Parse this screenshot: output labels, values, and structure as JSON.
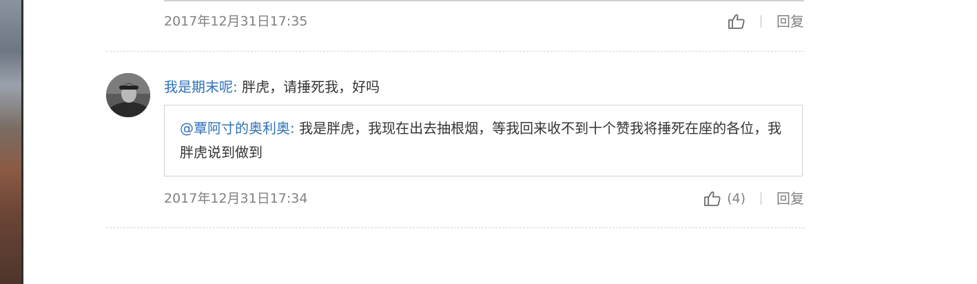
{
  "previous_comment": {
    "timestamp": "2017年12月31日17:35",
    "like_count": "",
    "reply_label": "回复"
  },
  "comment": {
    "username": "我是期末呢:",
    "text": " 胖虎，请捶死我，好吗",
    "quoted": {
      "username": "@覃阿寸的奥利奥:",
      "text": " 我是胖虎，我现在出去抽根烟，等我回来收不到十个赞我将捶死在座的各位，我胖虎说到做到"
    },
    "timestamp": "2017年12月31日17:34",
    "like_count": "(4)",
    "reply_label": "回复"
  },
  "colors": {
    "username": "#2f72b8",
    "meta": "#808080",
    "text": "#333333"
  },
  "icons": {
    "like": "thumbs-up-icon"
  }
}
